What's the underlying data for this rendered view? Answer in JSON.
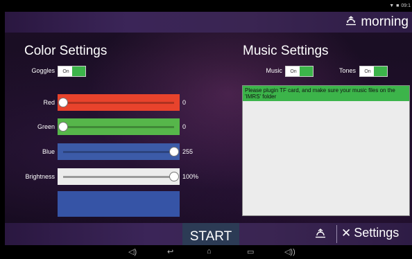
{
  "status_bar": {
    "wifi_icon": "wifi-icon",
    "battery_icon": "battery-icon",
    "time": "09:1"
  },
  "top_bar": {
    "icon": "sunrise-icon",
    "title": "morning"
  },
  "color_settings": {
    "title": "Color Settings",
    "goggles": {
      "label": "Goggles",
      "state": "On"
    },
    "sliders": [
      {
        "label": "Red",
        "value": "0",
        "fraction": 0.0,
        "color": "#e8432c"
      },
      {
        "label": "Green",
        "value": "0",
        "fraction": 0.0,
        "color": "#56b64a"
      },
      {
        "label": "Blue",
        "value": "255",
        "fraction": 1.0,
        "color": "#3c5ba8"
      },
      {
        "label": "Brightness",
        "value": "100%",
        "fraction": 1.0,
        "color": "#ececec"
      }
    ],
    "preview_color": "#3654a6"
  },
  "music_settings": {
    "title": "Music Settings",
    "music": {
      "label": "Music",
      "state": "On"
    },
    "tones": {
      "label": "Tones",
      "state": "On"
    },
    "message": "Please plugin TF card, and make sure your music files on the 'IMRS' folder"
  },
  "bottom_bar": {
    "start": "START",
    "alarm_icon": "sunrise-icon",
    "settings_icon": "tools-icon",
    "settings": "Settings"
  },
  "nav_bar": {
    "icons": [
      "volume-down-icon",
      "back-icon",
      "home-icon",
      "recents-icon",
      "volume-up-icon"
    ]
  }
}
